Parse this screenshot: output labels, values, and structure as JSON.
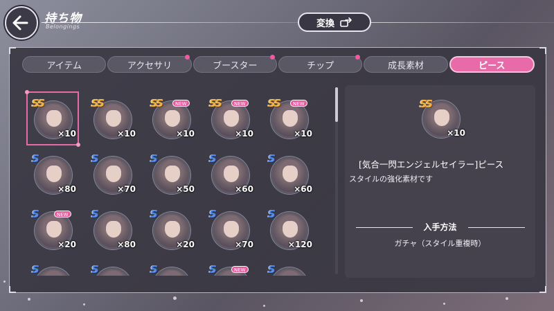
{
  "header": {
    "title": "持ち物",
    "subtitle": "Belongings",
    "convert_label": "変換"
  },
  "tabs": [
    {
      "label": "アイテム",
      "active": false,
      "dot": false
    },
    {
      "label": "アクセサリ",
      "active": false,
      "dot": true
    },
    {
      "label": "ブースター",
      "active": false,
      "dot": true
    },
    {
      "label": "チップ",
      "active": false,
      "dot": true
    },
    {
      "label": "成長素材",
      "active": false,
      "dot": false
    },
    {
      "label": "ピース",
      "active": true,
      "dot": false
    }
  ],
  "grid": {
    "rows": [
      [
        {
          "rank": "SS",
          "qty": "×10",
          "new": false,
          "selected": true
        },
        {
          "rank": "SS",
          "qty": "×10",
          "new": false,
          "selected": false
        },
        {
          "rank": "SS",
          "qty": "×10",
          "new": true,
          "selected": false
        },
        {
          "rank": "SS",
          "qty": "×10",
          "new": true,
          "selected": false
        },
        {
          "rank": "SS",
          "qty": "×10",
          "new": true,
          "selected": false
        }
      ],
      [
        {
          "rank": "S",
          "qty": "×80",
          "new": false,
          "selected": false
        },
        {
          "rank": "S",
          "qty": "×70",
          "new": false,
          "selected": false
        },
        {
          "rank": "S",
          "qty": "×50",
          "new": false,
          "selected": false
        },
        {
          "rank": "S",
          "qty": "×60",
          "new": false,
          "selected": false
        },
        {
          "rank": "S",
          "qty": "×60",
          "new": false,
          "selected": false
        }
      ],
      [
        {
          "rank": "S",
          "qty": "×20",
          "new": true,
          "selected": false
        },
        {
          "rank": "S",
          "qty": "×80",
          "new": false,
          "selected": false
        },
        {
          "rank": "S",
          "qty": "×20",
          "new": false,
          "selected": false
        },
        {
          "rank": "S",
          "qty": "×70",
          "new": false,
          "selected": false
        },
        {
          "rank": "S",
          "qty": "×120",
          "new": false,
          "selected": false
        }
      ],
      [
        {
          "rank": "S",
          "qty": "",
          "new": false,
          "selected": false
        },
        {
          "rank": "S",
          "qty": "",
          "new": false,
          "selected": false
        },
        {
          "rank": "S",
          "qty": "",
          "new": false,
          "selected": false
        },
        {
          "rank": "S",
          "qty": "",
          "new": true,
          "selected": false
        },
        {
          "rank": "S",
          "qty": "",
          "new": false,
          "selected": false
        }
      ]
    ],
    "new_label": "NEW"
  },
  "detail": {
    "rank": "SS",
    "qty": "×10",
    "name": "[気合一閃エンジェルセイラー]ピース",
    "description": "スタイルの強化素材です",
    "howto_label": "入手方法",
    "howto_value": "ガチャ（スタイル重複時）"
  },
  "colors": {
    "accent": "#e96aa8",
    "panel": "#3a3742",
    "ss_rank": "#f0b347",
    "s_rank": "#4f8ae8"
  }
}
